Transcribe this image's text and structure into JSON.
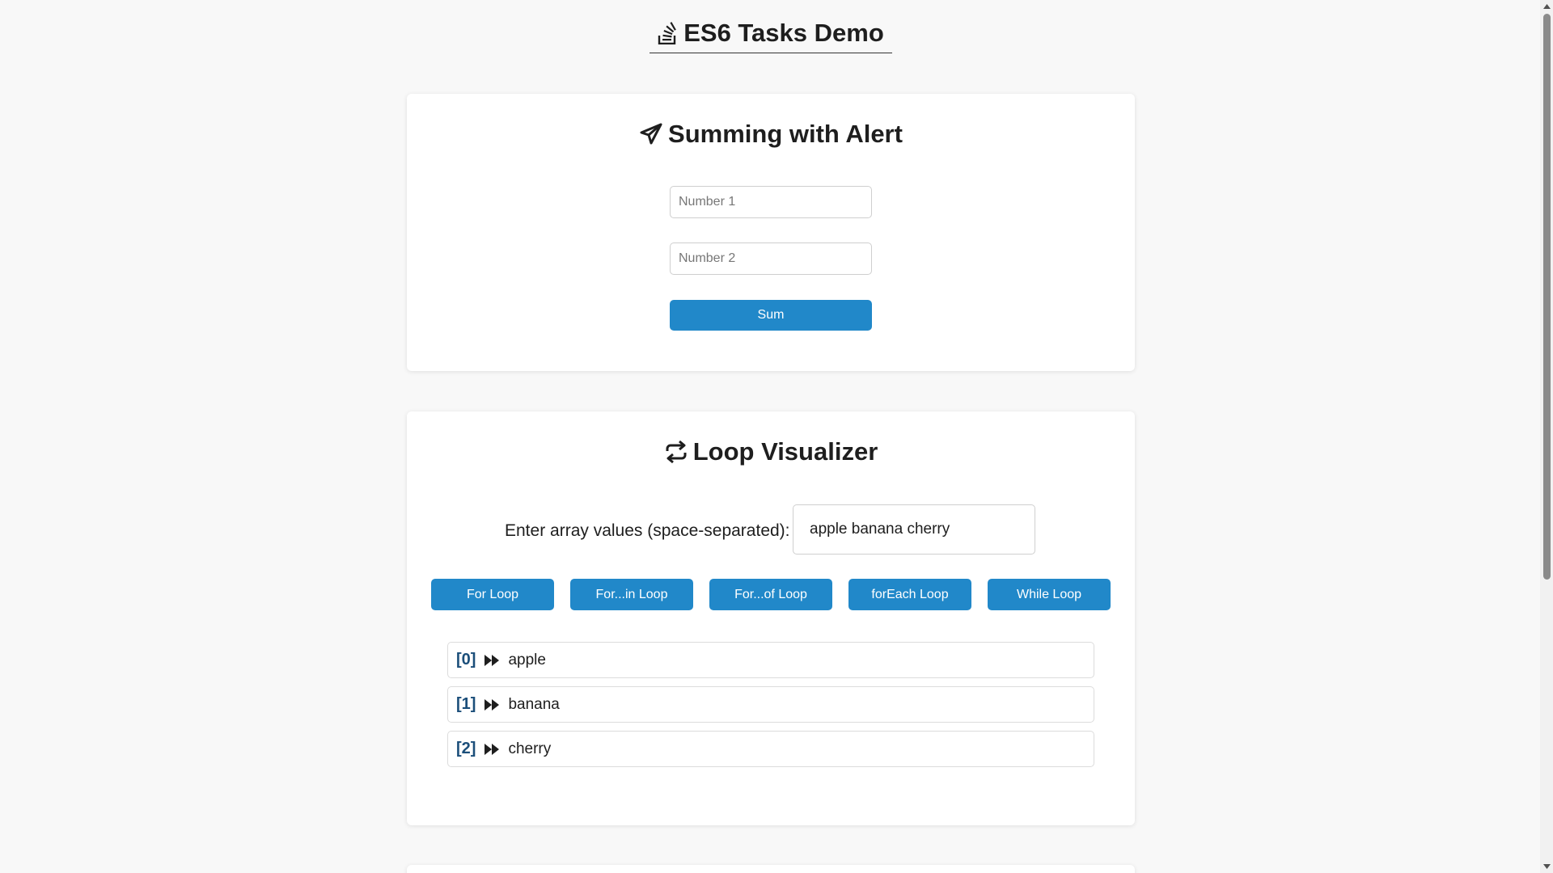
{
  "header": {
    "title": "ES6 Tasks Demo",
    "icon": "stack-overflow-icon"
  },
  "sum_card": {
    "title": "Summing with Alert",
    "icon": "paper-plane-icon",
    "input1_placeholder": "Number 1",
    "input2_placeholder": "Number 2",
    "button_label": "Sum"
  },
  "loop_card": {
    "title": "Loop Visualizer",
    "icon": "repeat-icon",
    "array_label": "Enter array values (space-separated):",
    "array_value": "apple banana cherry",
    "buttons": [
      "For Loop",
      "For...in Loop",
      "For...of Loop",
      "forEach Loop",
      "While Loop"
    ],
    "results": [
      {
        "index": "[0]",
        "value": "apple"
      },
      {
        "index": "[1]",
        "value": "banana"
      },
      {
        "index": "[2]",
        "value": "cherry"
      }
    ]
  },
  "colors": {
    "accent": "#2188c9",
    "index_text": "#1b4e7a",
    "background": "#f8f8f8"
  }
}
